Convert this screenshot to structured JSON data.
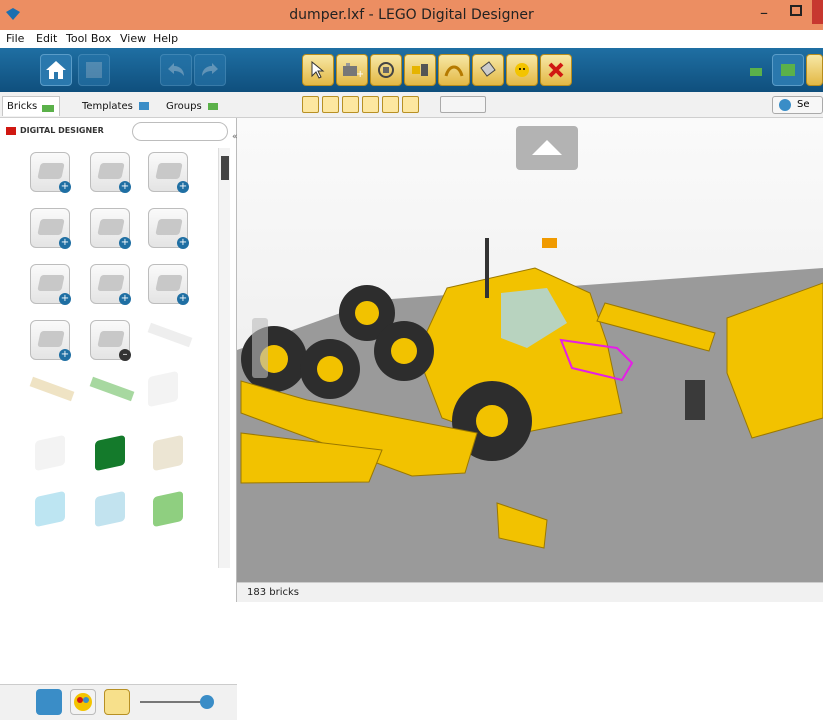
{
  "window": {
    "title": "dumper.lxf - LEGO Digital Designer"
  },
  "menu": [
    "File",
    "Edit",
    "Tool Box",
    "View",
    "Help"
  ],
  "tabs": [
    {
      "label": "Bricks",
      "active": true
    },
    {
      "label": "Templates",
      "active": false
    },
    {
      "label": "Groups",
      "active": false
    }
  ],
  "sidebar": {
    "logo_text": "DIGITAL DESIGNER"
  },
  "status": {
    "bricks_count": "183 bricks"
  },
  "colors": {
    "title_bar": "#ec8e62",
    "toolbar": "#1f6fa3",
    "lego_yellow": "#f2c200"
  },
  "toolbar": {
    "left": [
      "home-icon",
      "save-icon",
      "undo-icon",
      "redo-icon"
    ],
    "tools": [
      "select-tool",
      "clone-tool",
      "hinge-tool",
      "hinge-align-tool",
      "flex-tool",
      "paint-tool",
      "hide-tool",
      "delete-tool"
    ]
  },
  "viewport_button_right": "Se"
}
